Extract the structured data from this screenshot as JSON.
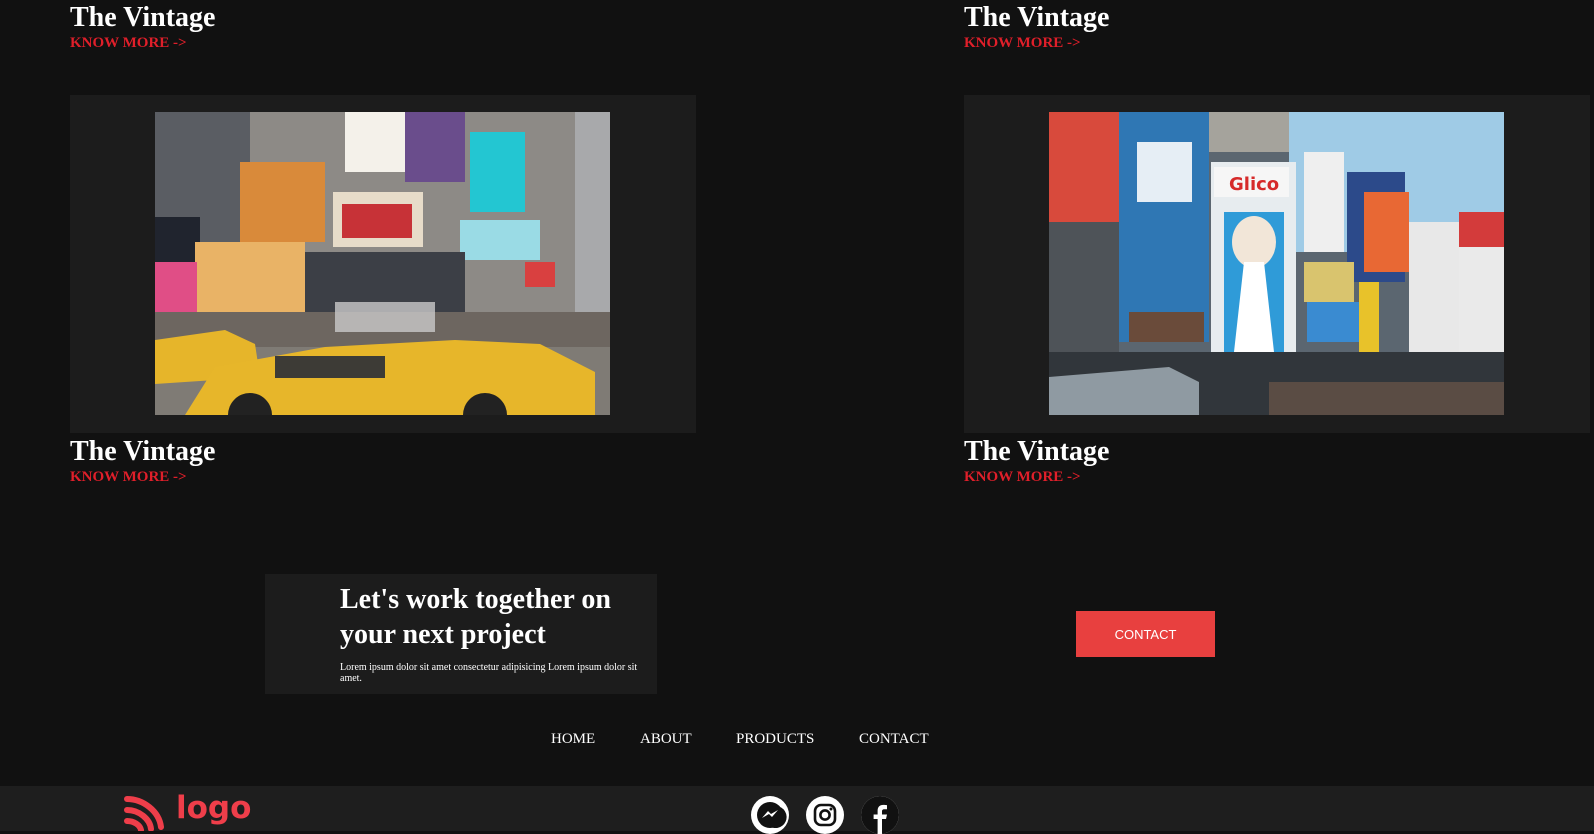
{
  "cards": [
    {
      "title": "The Vintage",
      "link": "KNOW MORE ->"
    },
    {
      "title": "The Vintage",
      "link": "KNOW MORE ->"
    },
    {
      "title": "The Vintage",
      "link": "KNOW MORE ->"
    },
    {
      "title": "The Vintage",
      "link": "KNOW MORE ->"
    }
  ],
  "cta": {
    "heading": "Let's work together on your next project",
    "subtext": "Lorem ipsum dolor sit amet consectetur adipisicing Lorem ipsum dolor sit amet.",
    "button_label": "CONTACT"
  },
  "nav": [
    "HOME",
    "ABOUT",
    "PRODUCTS",
    "CONTACT"
  ],
  "footer": {
    "logo_text": "logo",
    "social_icons": [
      "messenger-icon",
      "instagram-icon",
      "facebook-icon"
    ]
  },
  "colors": {
    "background": "#111111",
    "card_background": "#1c1c1c",
    "accent_red": "#e01f2a",
    "button_red": "#e8403f",
    "logo_red": "#ef3e4a"
  }
}
